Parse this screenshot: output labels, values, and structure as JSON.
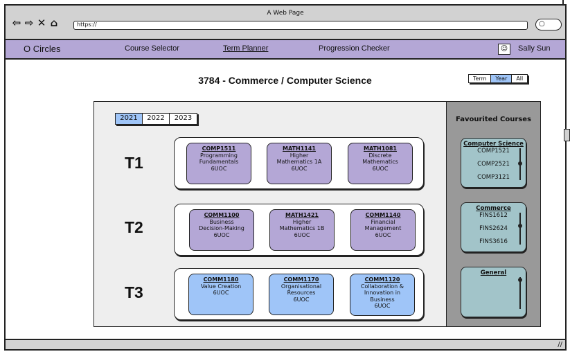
{
  "browser": {
    "window_title": "A Web Page",
    "url": "https://",
    "nav_icons": [
      "back-icon",
      "forward-icon",
      "close-icon",
      "home-icon"
    ],
    "search_icon": "search-icon"
  },
  "navbar": {
    "brand": "O Circles",
    "links": [
      "Course Selector",
      "Term Planner",
      "Progression Checker"
    ],
    "active": "Term Planner",
    "user_name": "Sally Sun",
    "bg_color": "#b4a7d6"
  },
  "degree_title": "3784 - Commerce / Computer Science",
  "view_toggle": {
    "options": [
      "Term",
      "Year",
      "All"
    ],
    "selected": "Year"
  },
  "year_tabs": {
    "options": [
      "2021",
      "2022",
      "2023"
    ],
    "selected": "2021"
  },
  "terms": [
    {
      "label": "T1",
      "courses": [
        {
          "code": "COMP1511",
          "name_lines": [
            "Programming",
            "Fundamentals"
          ],
          "uoc": "6UOC",
          "color": "purple"
        },
        {
          "code": "MATH1141",
          "name_lines": [
            "Higher",
            "Mathematics 1A"
          ],
          "uoc": "6UOC",
          "color": "purple"
        },
        {
          "code": "MATH1081",
          "name_lines": [
            "Discrete",
            "Mathematics"
          ],
          "uoc": "6UOC",
          "color": "purple"
        }
      ]
    },
    {
      "label": "T2",
      "courses": [
        {
          "code": "COMM1100",
          "name_lines": [
            "Business",
            "Decision-Making"
          ],
          "uoc": "6UOC",
          "color": "purple"
        },
        {
          "code": "MATH1421",
          "name_lines": [
            "Higher",
            "Mathematics 1B"
          ],
          "uoc": "6UOC",
          "color": "purple"
        },
        {
          "code": "COMM1140",
          "name_lines": [
            "Financial",
            "Management"
          ],
          "uoc": "6UOC",
          "color": "purple"
        }
      ]
    },
    {
      "label": "T3",
      "courses": [
        {
          "code": "COMM1180",
          "name_lines": [
            "Value Creation"
          ],
          "uoc": "6UOC",
          "color": "blue"
        },
        {
          "code": "COMM1170",
          "name_lines": [
            "Organisational",
            "Resources"
          ],
          "uoc": "6UOC",
          "color": "blue"
        },
        {
          "code": "COMM1120",
          "name_lines": [
            "Collaboration &",
            "Innovation in",
            "Business"
          ],
          "uoc": "6UOC",
          "color": "blue"
        }
      ]
    }
  ],
  "favourites": {
    "title": "Favourited Courses",
    "groups": [
      {
        "title": "Computer Science",
        "items": [
          "COMP1521",
          "COMP2521",
          "COMP3121"
        ]
      },
      {
        "title": "Commerce",
        "items": [
          "FINS1612",
          "FINS2624",
          "FINS3616"
        ]
      },
      {
        "title": "General",
        "items": []
      }
    ]
  },
  "colors": {
    "purple": "#b4a7d6",
    "blue": "#9fc5f8",
    "teal": "#a2c4c9",
    "panel_grey": "#999999"
  }
}
